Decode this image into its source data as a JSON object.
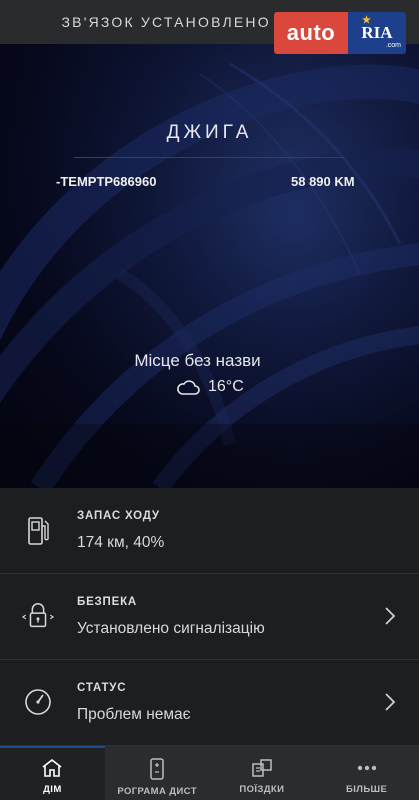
{
  "status": {
    "text": "ЗВ'ЯЗОК УСТАНОВЛЕНО ЩОЙНО"
  },
  "watermark": {
    "auto": "auto",
    "ria": "RIA",
    "com": ".com"
  },
  "vehicle": {
    "name": "ДЖИГА",
    "vin": "-TEMPTP686960",
    "odometer": "58 890 KM",
    "location": "Місце без назви",
    "temperature": "16°C",
    "weather_icon": "cloud-icon"
  },
  "info_rows": [
    {
      "title": "ЗАПАС ХОДУ",
      "value": "174 км, 40%",
      "icon": "fuel-pump-icon"
    },
    {
      "title": "БЕЗПЕКА",
      "value": "Установлено сигналізацію",
      "icon": "lock-icon"
    },
    {
      "title": "СТАТУС",
      "value": "Проблем немає",
      "icon": "gauge-icon"
    }
  ],
  "tabs": [
    {
      "label": "ДІМ",
      "icon": "home-icon",
      "active": true
    },
    {
      "label": "РОГРАМА ДИСТ",
      "icon": "remote-icon",
      "active": false
    },
    {
      "label": "ПОЇЗДКИ",
      "icon": "trips-icon",
      "active": false
    },
    {
      "label": "БІЛЬШЕ",
      "icon": "more-icon",
      "active": false
    }
  ]
}
